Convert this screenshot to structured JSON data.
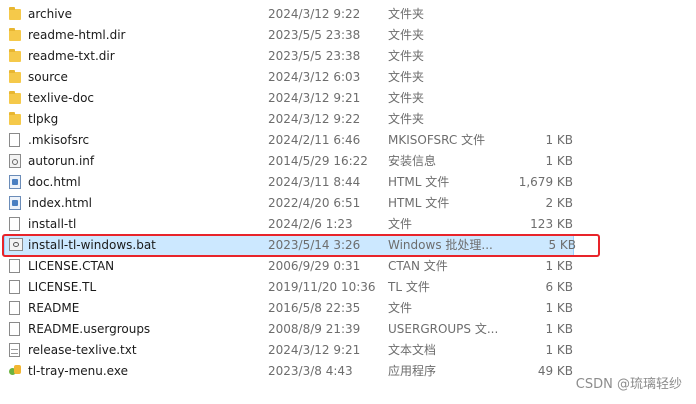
{
  "files": [
    {
      "name": "archive",
      "date": "2024/3/12 9:22",
      "type": "文件夹",
      "size": "",
      "icon": "folder-icon"
    },
    {
      "name": "readme-html.dir",
      "date": "2023/5/5 23:38",
      "type": "文件夹",
      "size": "",
      "icon": "folder-icon"
    },
    {
      "name": "readme-txt.dir",
      "date": "2023/5/5 23:38",
      "type": "文件夹",
      "size": "",
      "icon": "folder-icon"
    },
    {
      "name": "source",
      "date": "2024/3/12 6:03",
      "type": "文件夹",
      "size": "",
      "icon": "folder-icon"
    },
    {
      "name": "texlive-doc",
      "date": "2024/3/12 9:21",
      "type": "文件夹",
      "size": "",
      "icon": "folder-icon"
    },
    {
      "name": "tlpkg",
      "date": "2024/3/12 9:22",
      "type": "文件夹",
      "size": "",
      "icon": "folder-icon"
    },
    {
      "name": ".mkisofsrc",
      "date": "2024/2/11 6:46",
      "type": "MKISOFSRC 文件",
      "size": "1 KB",
      "icon": "file-icon"
    },
    {
      "name": "autorun.inf",
      "date": "2014/5/29 16:22",
      "type": "安装信息",
      "size": "1 KB",
      "icon": "setup-info-icon"
    },
    {
      "name": "doc.html",
      "date": "2024/3/11 8:44",
      "type": "HTML 文件",
      "size": "1,679 KB",
      "icon": "html-file-icon"
    },
    {
      "name": "index.html",
      "date": "2022/4/20 6:51",
      "type": "HTML 文件",
      "size": "2 KB",
      "icon": "html-file-icon"
    },
    {
      "name": "install-tl",
      "date": "2024/2/6 1:23",
      "type": "文件",
      "size": "123 KB",
      "icon": "file-icon"
    },
    {
      "name": "install-tl-windows.bat",
      "date": "2023/5/14 3:26",
      "type": "Windows 批处理...",
      "size": "5 KB",
      "icon": "batch-file-icon"
    },
    {
      "name": "LICENSE.CTAN",
      "date": "2006/9/29 0:31",
      "type": "CTAN 文件",
      "size": "1 KB",
      "icon": "file-icon"
    },
    {
      "name": "LICENSE.TL",
      "date": "2019/11/20 10:36",
      "type": "TL 文件",
      "size": "6 KB",
      "icon": "file-icon"
    },
    {
      "name": "README",
      "date": "2016/5/8 22:35",
      "type": "文件",
      "size": "1 KB",
      "icon": "file-icon"
    },
    {
      "name": "README.usergroups",
      "date": "2008/8/9 21:39",
      "type": "USERGROUPS 文...",
      "size": "1 KB",
      "icon": "file-icon"
    },
    {
      "name": "release-texlive.txt",
      "date": "2024/3/12 9:21",
      "type": "文本文档",
      "size": "1 KB",
      "icon": "text-file-icon"
    },
    {
      "name": "tl-tray-menu.exe",
      "date": "2023/3/8 4:43",
      "type": "应用程序",
      "size": "49 KB",
      "icon": "exe-icon"
    }
  ],
  "selected_index": 11,
  "watermark": "CSDN @琉璃轻纱",
  "colors": {
    "selection_bg": "#cce8ff",
    "highlight_border": "#e8242a",
    "folder": "#f5c94a"
  }
}
